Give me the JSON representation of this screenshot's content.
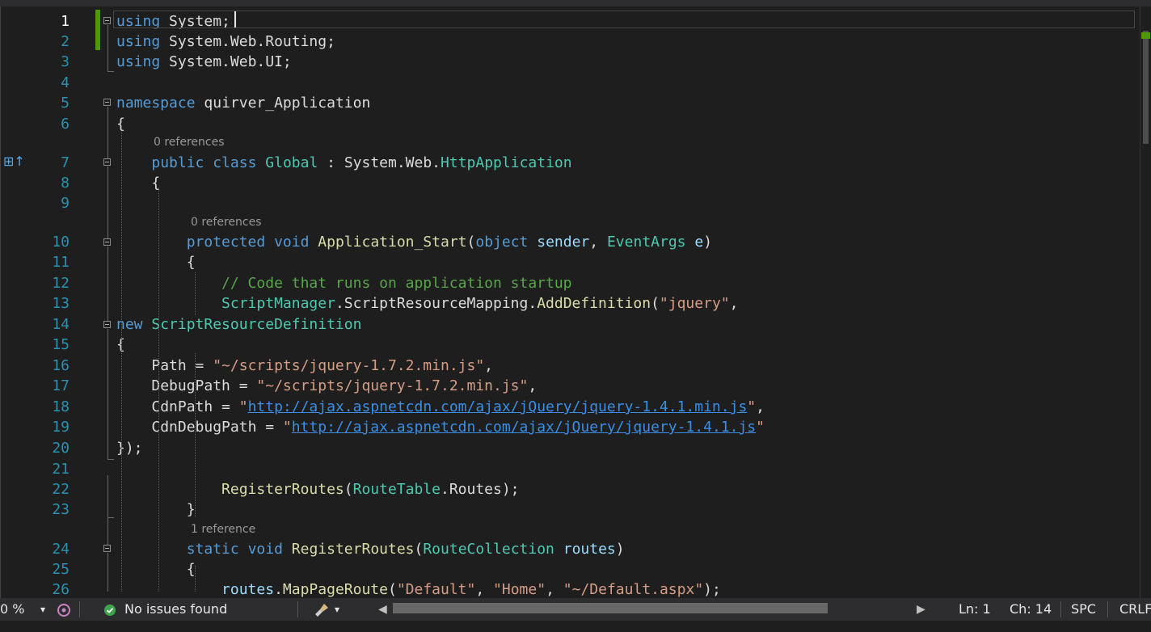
{
  "editor": {
    "lines": [
      {
        "n": "1",
        "html": "<span class=\"k\">using</span> <span class=\"p\">System;</span>"
      },
      {
        "n": "2",
        "html": "<span class=\"k\">using</span> <span class=\"p\">System.Web.Routing;</span>"
      },
      {
        "n": "3",
        "html": "<span class=\"k\">using</span> <span class=\"p\">System.Web.UI;</span>"
      },
      {
        "n": "4",
        "html": ""
      },
      {
        "n": "5",
        "html": "<span class=\"k\">namespace</span> <span class=\"p\">quirver_Application</span>"
      },
      {
        "n": "6",
        "html": "<span class=\"p\">{</span>"
      },
      {
        "n": "7",
        "html": "    <span class=\"k\">public</span> <span class=\"k\">class</span> <span class=\"t\">Global</span> <span class=\"p\">: System.Web.</span><span class=\"t\">HttpApplication</span>"
      },
      {
        "n": "8",
        "html": "    <span class=\"p\">{</span>"
      },
      {
        "n": "9",
        "html": ""
      },
      {
        "n": "10",
        "html": "        <span class=\"k\">protected</span> <span class=\"k\">void</span> <span class=\"m\">Application_Start</span><span class=\"p\">(</span><span class=\"k\">object</span> <span class=\"v\">sender</span><span class=\"p\">, </span><span class=\"t\">EventArgs</span> <span class=\"v\">e</span><span class=\"p\">)</span>"
      },
      {
        "n": "11",
        "html": "        <span class=\"p\">{</span>"
      },
      {
        "n": "12",
        "html": "            <span class=\"c\">// Code that runs on application startup</span>"
      },
      {
        "n": "13",
        "html": "            <span class=\"t\">ScriptManager</span><span class=\"p\">.ScriptResourceMapping.</span><span class=\"m\">AddDefinition</span><span class=\"p\">(</span><span class=\"s\">\"jquery\"</span><span class=\"p\">,</span>"
      },
      {
        "n": "14",
        "html": "<span class=\"k\">new</span> <span class=\"t\">ScriptResourceDefinition</span>"
      },
      {
        "n": "15",
        "html": "<span class=\"p\">{</span>"
      },
      {
        "n": "16",
        "html": "    <span class=\"p\">Path = </span><span class=\"s\">\"~/scripts/jquery-1.7.2.min.js\"</span><span class=\"p\">,</span>"
      },
      {
        "n": "17",
        "html": "    <span class=\"p\">DebugPath = </span><span class=\"s\">\"~/scripts/jquery-1.7.2.min.js\"</span><span class=\"p\">,</span>"
      },
      {
        "n": "18",
        "html": "    <span class=\"p\">CdnPath = </span><span class=\"s\">\"</span><span class=\"u\">http://ajax.aspnetcdn.com/ajax/jQuery/jquery-1.4.1.min.js</span><span class=\"s\">\"</span><span class=\"p\">,</span>"
      },
      {
        "n": "19",
        "html": "    <span class=\"p\">CdnDebugPath = </span><span class=\"s\">\"</span><span class=\"u\">http://ajax.aspnetcdn.com/ajax/jQuery/jquery-1.4.1.js</span><span class=\"s\">\"</span>"
      },
      {
        "n": "20",
        "html": "<span class=\"p\">});</span>"
      },
      {
        "n": "21",
        "html": ""
      },
      {
        "n": "22",
        "html": "            <span class=\"m\">RegisterRoutes</span><span class=\"p\">(</span><span class=\"t\">RouteTable</span><span class=\"p\">.Routes);</span>"
      },
      {
        "n": "23",
        "html": "        <span class=\"p\">}</span>"
      },
      {
        "n": "24",
        "html": "        <span class=\"k\">static</span> <span class=\"k\">void</span> <span class=\"m\">RegisterRoutes</span><span class=\"p\">(</span><span class=\"t\">RouteCollection</span> <span class=\"v\">routes</span><span class=\"p\">)</span>"
      },
      {
        "n": "25",
        "html": "        <span class=\"p\">{</span>"
      },
      {
        "n": "26",
        "html": "            <span class=\"v\">routes</span><span class=\"p\">.</span><span class=\"m\">MapPageRoute</span><span class=\"p\">(</span><span class=\"s\">\"Default\"</span><span class=\"p\">, </span><span class=\"s\">\"Home\"</span><span class=\"p\">, </span><span class=\"s\">\"~/Default.aspx\"</span><span class=\"p\">);</span>"
      }
    ],
    "codelens": {
      "class_global": "0 references",
      "application_start": "0 references",
      "register_routes": "1 reference"
    }
  },
  "statusbar": {
    "zoom": "0 %",
    "zoom_arrow": "▾",
    "issues_text": "No issues found",
    "brush_arrow": "▾",
    "scroll_left": "◀",
    "scroll_right": "▶",
    "line": "Ln: 1",
    "column": "Ch: 14",
    "whitespace": "SPC",
    "line_endings": "CRLF"
  },
  "colors": {
    "keyword": "#569cd6",
    "type": "#4ec9b0",
    "method": "#dcdcaa",
    "string": "#d69d85",
    "comment": "#57a64a",
    "line_number": "#2b91af",
    "change_bar": "#4e9a06"
  },
  "icons": {
    "margin": "class-override-icon",
    "issues": "check-circle-icon",
    "cleanup": "brush-icon",
    "intellicode": "intellicode-icon"
  }
}
